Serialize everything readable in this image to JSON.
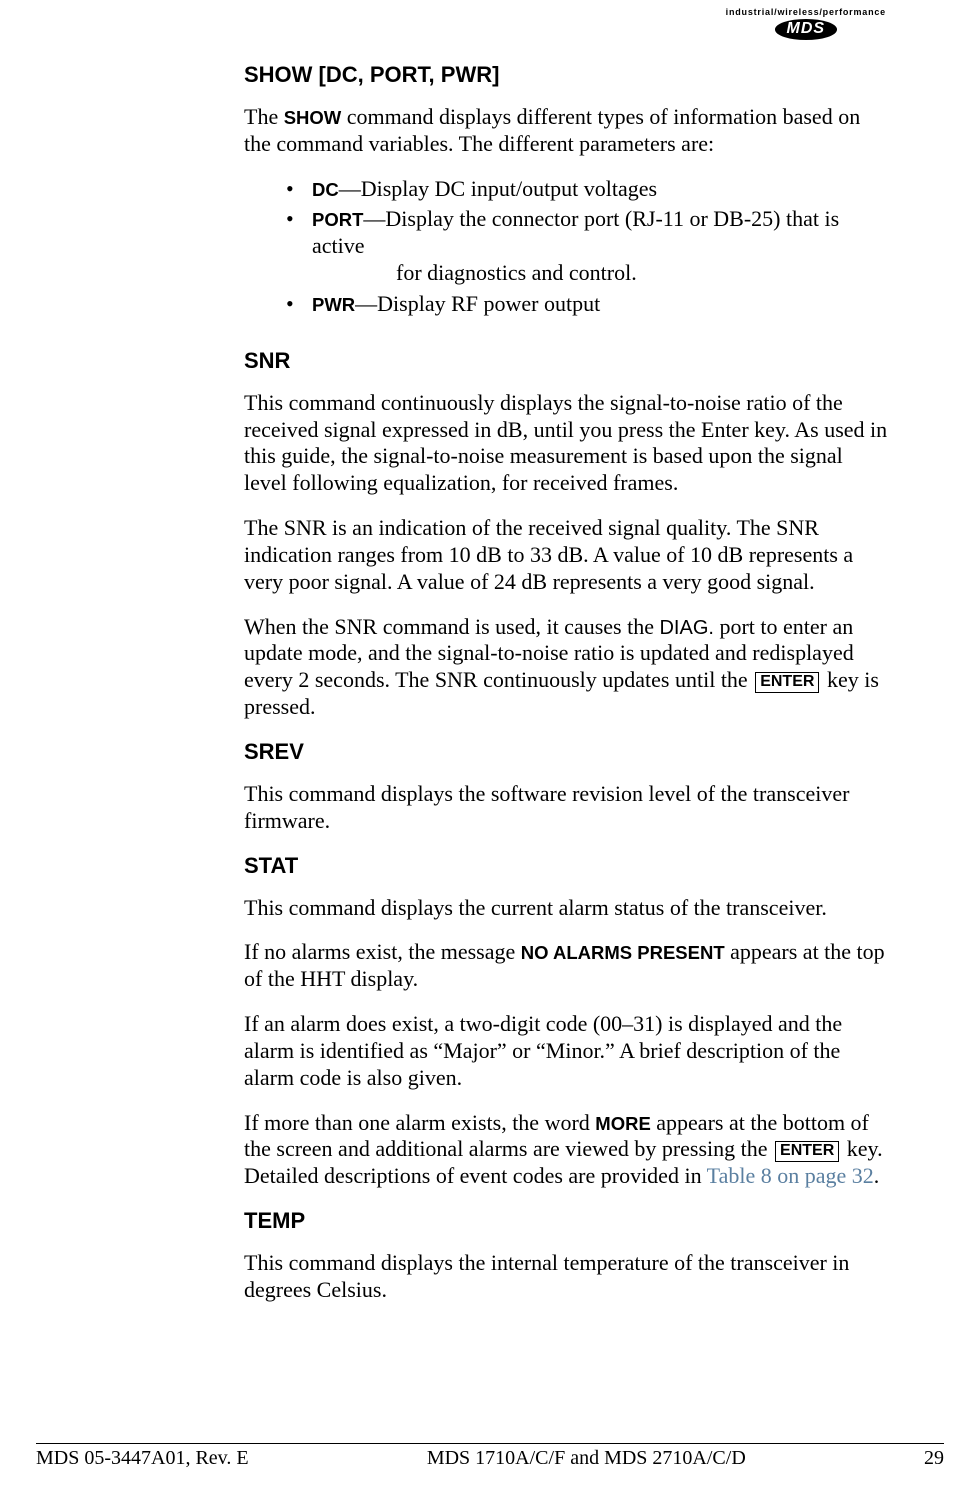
{
  "logo": {
    "tagline": "industrial/wireless/performance",
    "brand": "MDS"
  },
  "sections": {
    "show": {
      "heading": "SHOW [DC, PORT, PWR]",
      "intro_pre": "The ",
      "intro_cmd": "SHOW",
      "intro_post": " command displays different types of information based on the command variables. The different parameters are:",
      "items": {
        "dc": {
          "cmd": "DC",
          "text": "—Display DC input/output voltages"
        },
        "port": {
          "cmd": "PORT",
          "text1": "—Display the connector port (RJ-11 or DB-25) that is active",
          "text2": "for diagnostics and control."
        },
        "pwr": {
          "cmd": "PWR",
          "text": "—Display RF power output"
        }
      }
    },
    "snr": {
      "heading": "SNR",
      "p1": "This command continuously displays the signal-to-noise ratio of the received signal expressed in dB, until you press the Enter key. As used in this guide, the signal-to-noise measurement is based upon the signal level following equalization, for received frames.",
      "p2": "The SNR is an indication of the received signal quality. The SNR indication ranges from 10 dB to 33 dB. A value of 10 dB represents a very poor signal. A value of 24 dB represents a very good signal.",
      "p3_pre": "When the SNR command is used, it causes the ",
      "p3_diag": "DIAG.",
      "p3_mid": " port to enter an update mode, and the signal-to-noise ratio is updated and redisplayed every 2 seconds. The SNR continuously updates until the ",
      "p3_key": "ENTER",
      "p3_post": " key is pressed."
    },
    "srev": {
      "heading": "SREV",
      "p1": "This command displays the software revision level of the transceiver firmware."
    },
    "stat": {
      "heading": "STAT",
      "p1": "This command displays the current alarm status of the transceiver.",
      "p2_pre": "If no alarms exist, the message ",
      "p2_cmd": "NO ALARMS PRESENT",
      "p2_post": " appears at the top of the HHT display.",
      "p3": "If an alarm does exist, a two-digit code (00–31) is displayed and the alarm is identified as “Major” or “Minor.” A brief description of the alarm code is also given.",
      "p4_pre": "If more than one alarm exists, the word ",
      "p4_cmd": "MORE",
      "p4_mid": " appears at the bottom of the screen and additional alarms are viewed by pressing the ",
      "p4_key": "ENTER",
      "p4_mid2": " key. Detailed descriptions of event codes are provided in ",
      "p4_xref": "Table 8 on page 32",
      "p4_post": "."
    },
    "temp": {
      "heading": "TEMP",
      "p1": "This command displays the internal temperature of the transceiver in degrees Celsius."
    }
  },
  "footer": {
    "left": "MDS 05-3447A01, Rev. E",
    "center": "MDS 1710A/C/F and MDS 2710A/C/D",
    "right": "29"
  }
}
